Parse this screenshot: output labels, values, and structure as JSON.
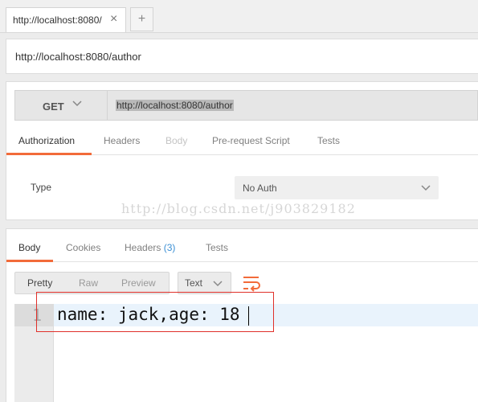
{
  "tab": {
    "label": "http://localhost:8080/",
    "close": "×",
    "new": "+"
  },
  "title_url": "http://localhost:8080/author",
  "request": {
    "method": "GET",
    "url": "http://localhost:8080/author",
    "tabs": [
      "Authorization",
      "Headers",
      "Body",
      "Pre-request Script",
      "Tests"
    ]
  },
  "auth": {
    "type_label": "Type",
    "selected": "No Auth"
  },
  "watermark": "http://blog.csdn.net/j903829182",
  "response": {
    "tabs": {
      "body": "Body",
      "cookies": "Cookies",
      "headers": "Headers",
      "headers_count": "(3)",
      "tests": "Tests"
    },
    "views": [
      "Pretty",
      "Raw",
      "Preview"
    ],
    "format": "Text",
    "line_number": "1",
    "body_text": "name: jack,age: 18"
  },
  "colors": {
    "accent": "#f26b3a",
    "highlight_box": "#e0302a",
    "badge": "#3b8fd4"
  }
}
